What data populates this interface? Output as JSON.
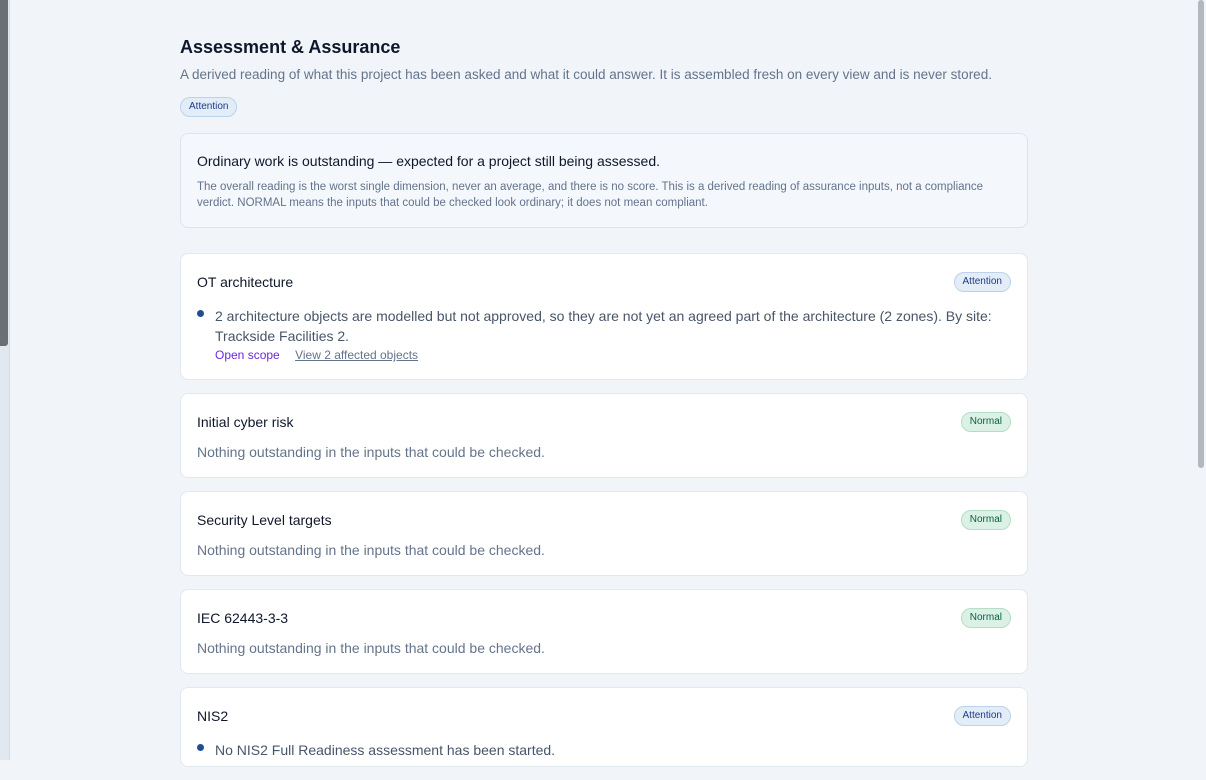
{
  "page": {
    "title": "Assessment & Assurance",
    "intro": "A derived reading of what this project has been asked and what it could answer. It is assembled fresh on every view and is never stored.",
    "overall_status": "Attention"
  },
  "summary": {
    "headline": "Ordinary work is outstanding — expected for a project still being assessed.",
    "note": "The overall reading is the worst single dimension, never an average, and there is no score. This is a derived reading of assurance inputs, not a compliance verdict. NORMAL means the inputs that could be checked look ordinary; it does not mean compliant."
  },
  "dimensions": [
    {
      "title": "OT architecture",
      "status": "Attention",
      "finding": "2 architecture objects are modelled but not approved, so they are not yet an agreed part of the architecture (2 zones). By site: Trackside Facilities 2.",
      "link_scope": "Open scope",
      "link_affected": "View 2 affected objects"
    },
    {
      "title": "Initial cyber risk",
      "status": "Normal",
      "empty_text": "Nothing outstanding in the inputs that could be checked."
    },
    {
      "title": "Security Level targets",
      "status": "Normal",
      "empty_text": "Nothing outstanding in the inputs that could be checked."
    },
    {
      "title": "IEC 62443-3-3",
      "status": "Normal",
      "empty_text": "Nothing outstanding in the inputs that could be checked."
    },
    {
      "title": "NIS2",
      "status": "Attention",
      "finding": "No NIS2 Full Readiness assessment has been started."
    }
  ],
  "colors": {
    "attention_bg": "#e2edf8",
    "attention_text": "#1e3a8a",
    "normal_bg": "#dcf1e6",
    "normal_text": "#065f46",
    "finding_dot": "#1e4f91",
    "link_scope": "#6d28d9"
  }
}
